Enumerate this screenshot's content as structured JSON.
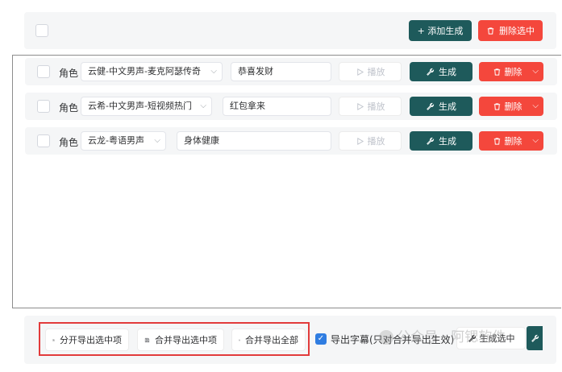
{
  "toolbar": {
    "add_label": "+ 添加生成",
    "delete_selected_label": "删除选中"
  },
  "role_label": "角色",
  "play_label": "播放",
  "generate_label": "生成",
  "delete_label": "删除",
  "rows": [
    {
      "voice": "云健-中文男声-麦克阿瑟传奇",
      "text": "恭喜发财"
    },
    {
      "voice": "云希-中文男声-短视频热门",
      "text": "红包拿来"
    },
    {
      "voice": "云龙-粤语男声",
      "text": "身体健康"
    }
  ],
  "bottom": {
    "split_export_label": "分开导出选中项",
    "merge_export_label": "合并导出选中项",
    "merge_all_label": "合并导出全部",
    "subtitle_label": "导出字幕(只对合并导出生效)",
    "generate_selected_label": "生成选中"
  },
  "watermark": "公众号 · 阿锶软件",
  "colors": {
    "primary": "#1e5a5b",
    "danger": "#f4473c",
    "check": "#2f7de1"
  }
}
